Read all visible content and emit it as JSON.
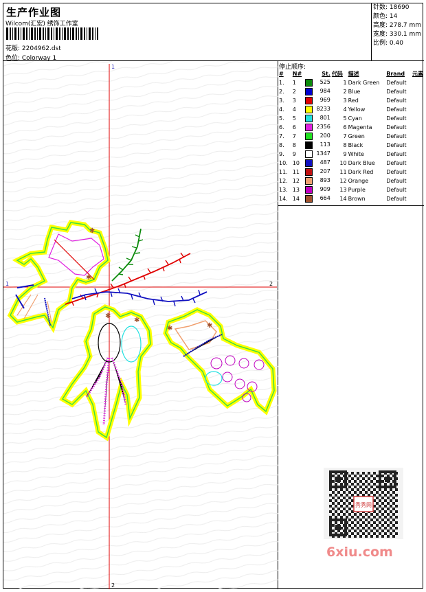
{
  "header": {
    "title": "生产作业图",
    "company": "Wilcom(汇宏) 绣饰工作室",
    "design": "花版: 2204962.dst",
    "colorway": "色位: Colorway 1"
  },
  "stats": {
    "stitches": "针数: 18690",
    "colors": "颜色: 14",
    "height": "高度: 278.7 mm",
    "width": "宽度: 330.1 mm",
    "ratio": "比例: 0.40"
  },
  "stop_sequence": {
    "title": "停止顺序:",
    "headers": [
      "#",
      "N#",
      "St.",
      "代码",
      "描述",
      "Brand",
      "元素"
    ],
    "rows": [
      {
        "idx": "1.",
        "n": "1",
        "color": "#0a8a0a",
        "st": "525",
        "code": "1",
        "desc": "Dark Green",
        "brand": "Default"
      },
      {
        "idx": "2.",
        "n": "2",
        "color": "#0000d0",
        "st": "984",
        "code": "2",
        "desc": "Blue",
        "brand": "Default"
      },
      {
        "idx": "3.",
        "n": "3",
        "color": "#e00000",
        "st": "969",
        "code": "3",
        "desc": "Red",
        "brand": "Default"
      },
      {
        "idx": "4.",
        "n": "4",
        "color": "#ffff00",
        "st": "8233",
        "code": "4",
        "desc": "Yellow",
        "brand": "Default"
      },
      {
        "idx": "5.",
        "n": "5",
        "color": "#20e0e0",
        "st": "801",
        "code": "5",
        "desc": "Cyan",
        "brand": "Default"
      },
      {
        "idx": "6.",
        "n": "6",
        "color": "#e020e0",
        "st": "2356",
        "code": "6",
        "desc": "Magenta",
        "brand": "Default"
      },
      {
        "idx": "7.",
        "n": "7",
        "color": "#20e020",
        "st": "200",
        "code": "7",
        "desc": "Green",
        "brand": "Default"
      },
      {
        "idx": "8.",
        "n": "8",
        "color": "#000000",
        "st": "113",
        "code": "8",
        "desc": "Black",
        "brand": "Default"
      },
      {
        "idx": "9.",
        "n": "9",
        "color": "#ffffff",
        "st": "1347",
        "code": "9",
        "desc": "White",
        "brand": "Default"
      },
      {
        "idx": "10.",
        "n": "10",
        "color": "#1010c0",
        "st": "487",
        "code": "10",
        "desc": "Dark Blue",
        "brand": "Default"
      },
      {
        "idx": "11.",
        "n": "11",
        "color": "#c01010",
        "st": "207",
        "code": "11",
        "desc": "Dark Red",
        "brand": "Default"
      },
      {
        "idx": "12.",
        "n": "12",
        "color": "#f0a070",
        "st": "893",
        "code": "12",
        "desc": "Orange",
        "brand": "Default"
      },
      {
        "idx": "13.",
        "n": "13",
        "color": "#c000c0",
        "st": "909",
        "code": "13",
        "desc": "Purple",
        "brand": "Default"
      },
      {
        "idx": "14.",
        "n": "14",
        "color": "#a0522d",
        "st": "664",
        "code": "14",
        "desc": "Brown",
        "brand": "Default"
      }
    ]
  },
  "axes": {
    "top": "1",
    "bottom": "2",
    "left": "1",
    "right": "2"
  },
  "watermark": "6xiu.com",
  "seal": "秀秀网"
}
